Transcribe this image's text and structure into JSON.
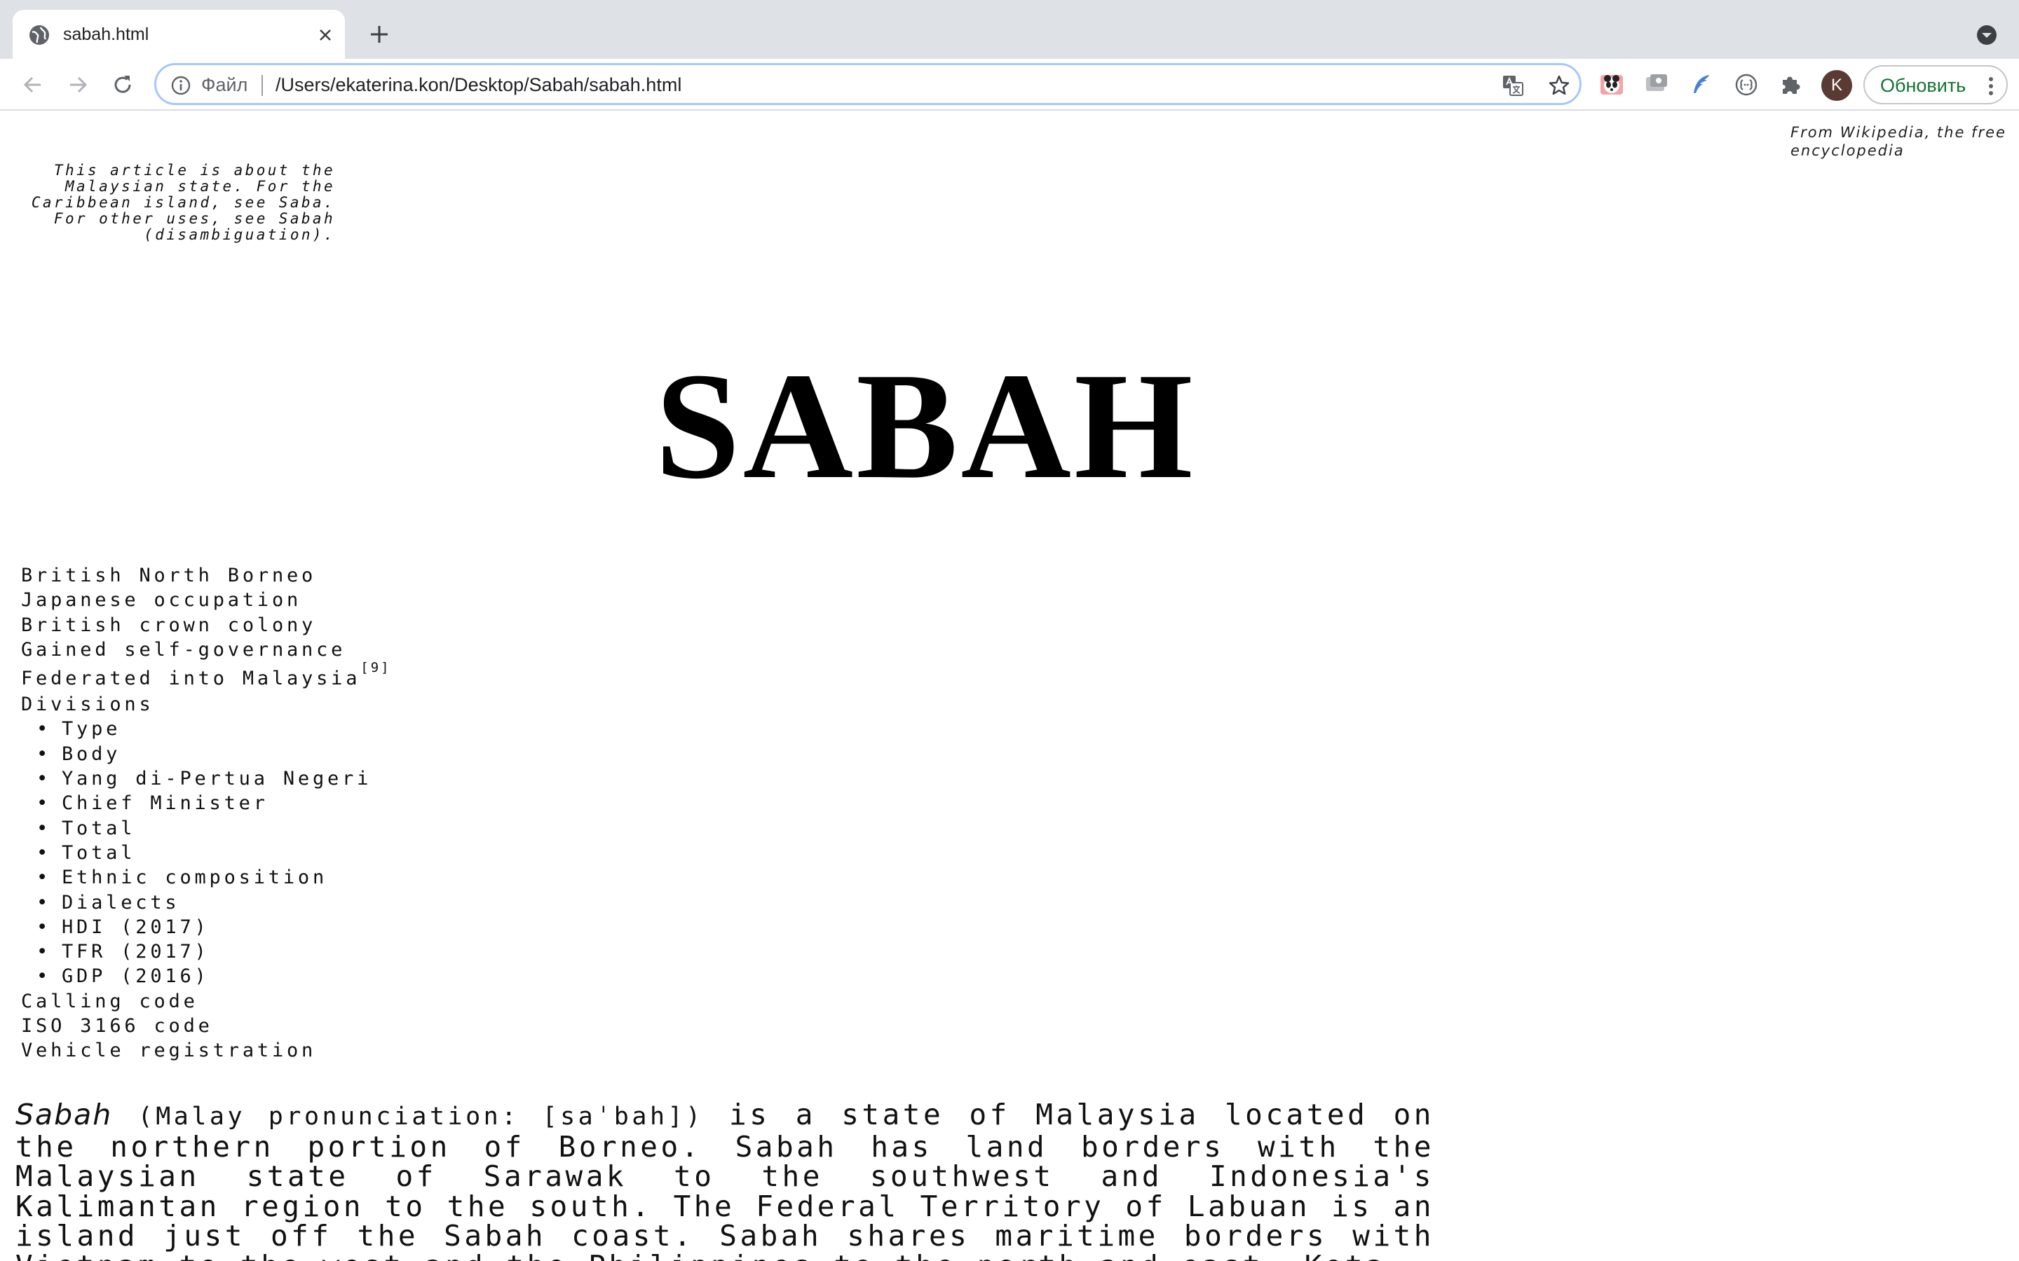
{
  "browser": {
    "tab_title": "sabah.html",
    "url_scheme_label": "Файл",
    "url": "/Users/ekaterina.kon/Desktop/Sabah/sabah.html",
    "avatar_letter": "K",
    "update_label": "Обновить",
    "colors": {
      "tabstrip": "#dee1e6",
      "omnibox_focus": "#a8c7fa",
      "update_text": "#137333",
      "avatar": "#5a3b33"
    }
  },
  "page": {
    "wiki_note": "From Wikipedia, the free encyclopedia",
    "hatnote": "This article is about the Malaysian state. For the Caribbean island, see Saba. For other uses, see Sabah (disambiguation).",
    "title": "SABAH",
    "infobox": {
      "items": [
        {
          "label": "British North Borneo"
        },
        {
          "label": "Japanese occupation"
        },
        {
          "label": "British crown colony"
        },
        {
          "label": "Gained self-governance"
        },
        {
          "label": "Federated into Malaysia",
          "sup": "[9]"
        },
        {
          "label": "Divisions"
        }
      ],
      "bullet_char": "•",
      "sub_items": [
        "Type",
        "Body",
        "Yang di-Pertua Negeri",
        "Chief Minister",
        "Total",
        "Total",
        "Ethnic composition",
        "Dialects",
        "HDI (2017)",
        "TFR (2017)",
        "GDP (2016)"
      ],
      "tail_items": [
        "Calling code",
        "ISO 3166 code",
        "Vehicle registration"
      ]
    },
    "lead": {
      "term": "Sabah",
      "pronunciation": "(Malay pronunciation: [saˈbah])",
      "text": " is a state of Malaysia located on the northern portion of Borneo. Sabah has land borders with the Malaysian state of Sarawak to the southwest and Indonesia's Kalimantan region to the south. The Federal Territory of Labuan is an island just off the Sabah coast. Sabah shares maritime borders with Vietnam to the west and the Philippines to the north and east. Kota"
    }
  }
}
